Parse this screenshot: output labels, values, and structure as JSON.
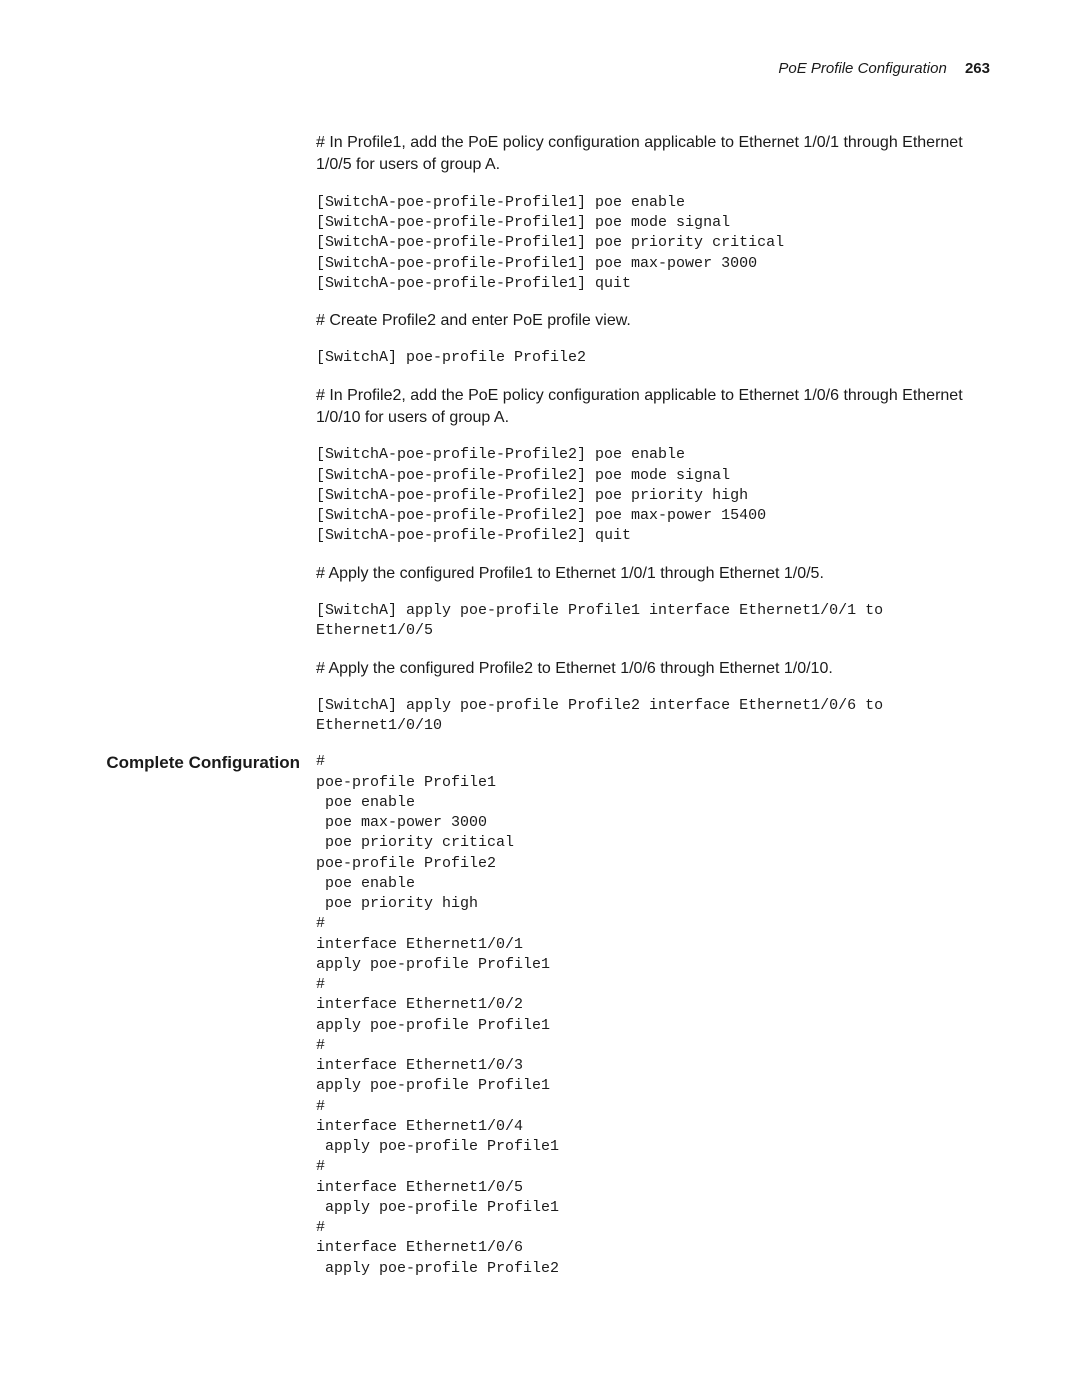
{
  "header": {
    "title": "PoE Profile Configuration",
    "page_number": "263"
  },
  "body": {
    "p1": "# In Profile1, add the PoE policy configuration applicable to Ethernet 1/0/1 through Ethernet 1/0/5 for users of group A.",
    "code1": "[SwitchA-poe-profile-Profile1] poe enable\n[SwitchA-poe-profile-Profile1] poe mode signal\n[SwitchA-poe-profile-Profile1] poe priority critical\n[SwitchA-poe-profile-Profile1] poe max-power 3000\n[SwitchA-poe-profile-Profile1] quit",
    "p2": "# Create Profile2 and enter PoE profile view.",
    "code2": "[SwitchA] poe-profile Profile2",
    "p3": "# In Profile2, add the PoE policy configuration applicable to Ethernet 1/0/6 through Ethernet 1/0/10 for users of group A.",
    "code3": "[SwitchA-poe-profile-Profile2] poe enable\n[SwitchA-poe-profile-Profile2] poe mode signal\n[SwitchA-poe-profile-Profile2] poe priority high\n[SwitchA-poe-profile-Profile2] poe max-power 15400\n[SwitchA-poe-profile-Profile2] quit",
    "p4": "# Apply the configured Profile1 to Ethernet 1/0/1 through Ethernet 1/0/5.",
    "code4": "[SwitchA] apply poe-profile Profile1 interface Ethernet1/0/1 to Ethernet1/0/5",
    "p5": "# Apply the configured Profile2 to Ethernet 1/0/6 through Ethernet 1/0/10.",
    "code5": "[SwitchA] apply poe-profile Profile2 interface Ethernet1/0/6 to Ethernet1/0/10"
  },
  "config_section_label": "Complete Configuration",
  "config_code": "#\npoe-profile Profile1\n poe enable\n poe max-power 3000\n poe priority critical\npoe-profile Profile2\n poe enable\n poe priority high\n#\ninterface Ethernet1/0/1\napply poe-profile Profile1\n#\ninterface Ethernet1/0/2\napply poe-profile Profile1\n#\ninterface Ethernet1/0/3\napply poe-profile Profile1\n#\ninterface Ethernet1/0/4\n apply poe-profile Profile1\n#\ninterface Ethernet1/0/5\n apply poe-profile Profile1\n#\ninterface Ethernet1/0/6\n apply poe-profile Profile2"
}
